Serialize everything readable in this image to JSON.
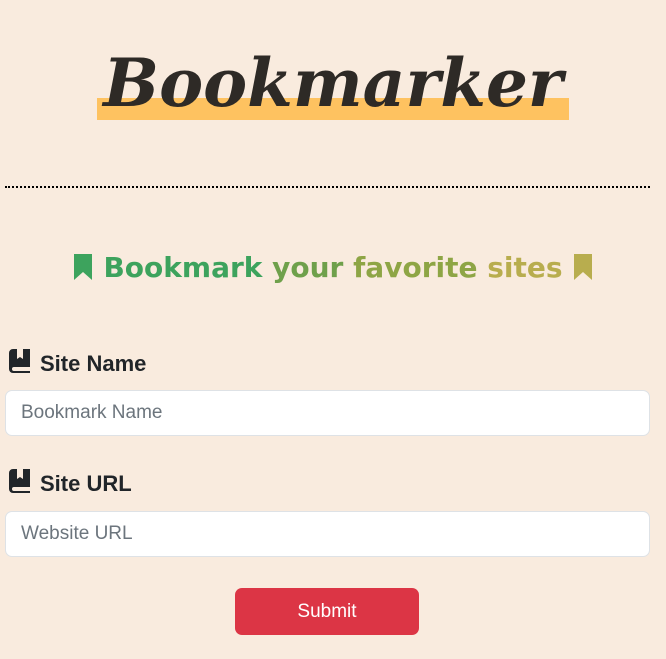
{
  "app": {
    "title": "Bookmarker"
  },
  "tagline": {
    "part1": "Bookmark",
    "part2": " your",
    "part3": " favorite",
    "part4": " sites",
    "colors": [
      "#3da35d",
      "#6fa04b",
      "#8ea545",
      "#b8ad4e"
    ],
    "icons": [
      "bookmark-icon",
      "bookmark-icon"
    ]
  },
  "form": {
    "site_name": {
      "label": "Site Name",
      "placeholder": "Bookmark Name",
      "value": "",
      "icon": "book-bookmark-icon"
    },
    "site_url": {
      "label": "Site URL",
      "placeholder": "Website URL",
      "value": "",
      "icon": "book-bookmark-icon"
    },
    "submit_label": "Submit"
  },
  "colors": {
    "background": "#f9ebde",
    "highlight": "#fec260",
    "submit": "#dc3545",
    "text": "#212529"
  }
}
